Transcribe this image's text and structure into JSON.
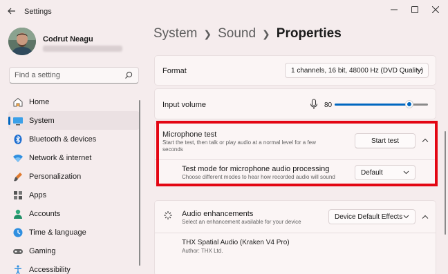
{
  "window": {
    "title": "Settings"
  },
  "profile": {
    "name": "Codrut Neagu"
  },
  "search": {
    "placeholder": "Find a setting"
  },
  "sidebar": {
    "items": [
      {
        "label": "Home",
        "icon": "home-icon"
      },
      {
        "label": "System",
        "icon": "system-icon",
        "active": true
      },
      {
        "label": "Bluetooth & devices",
        "icon": "bluetooth-icon"
      },
      {
        "label": "Network & internet",
        "icon": "network-icon"
      },
      {
        "label": "Personalization",
        "icon": "personalization-icon"
      },
      {
        "label": "Apps",
        "icon": "apps-icon"
      },
      {
        "label": "Accounts",
        "icon": "accounts-icon"
      },
      {
        "label": "Time & language",
        "icon": "time-language-icon"
      },
      {
        "label": "Gaming",
        "icon": "gaming-icon"
      },
      {
        "label": "Accessibility",
        "icon": "accessibility-icon"
      }
    ]
  },
  "breadcrumb": {
    "part1": "System",
    "part2": "Sound",
    "current": "Properties"
  },
  "format": {
    "label": "Format",
    "value": "1 channels, 16 bit, 48000 Hz (DVD Quality)"
  },
  "input_volume": {
    "label": "Input volume",
    "value": "80",
    "level": 0.8
  },
  "mic_test": {
    "title": "Microphone test",
    "description": "Start the test, then talk or play audio at a normal level for a few seconds",
    "button": "Start test"
  },
  "test_mode": {
    "title": "Test mode for microphone audio processing",
    "description": "Choose different modes to hear how recorded audio will sound",
    "value": "Default"
  },
  "enhancements": {
    "title": "Audio enhancements",
    "description": "Select an enhancement available for your device",
    "value": "Device Default Effects"
  },
  "spatial": {
    "title": "THX Spatial Audio (Kraken V4 Pro)",
    "author": "Author: THX Ltd."
  },
  "colors": {
    "accent": "#0067c0",
    "highlight": "#e30613",
    "background": "#f5eced"
  }
}
